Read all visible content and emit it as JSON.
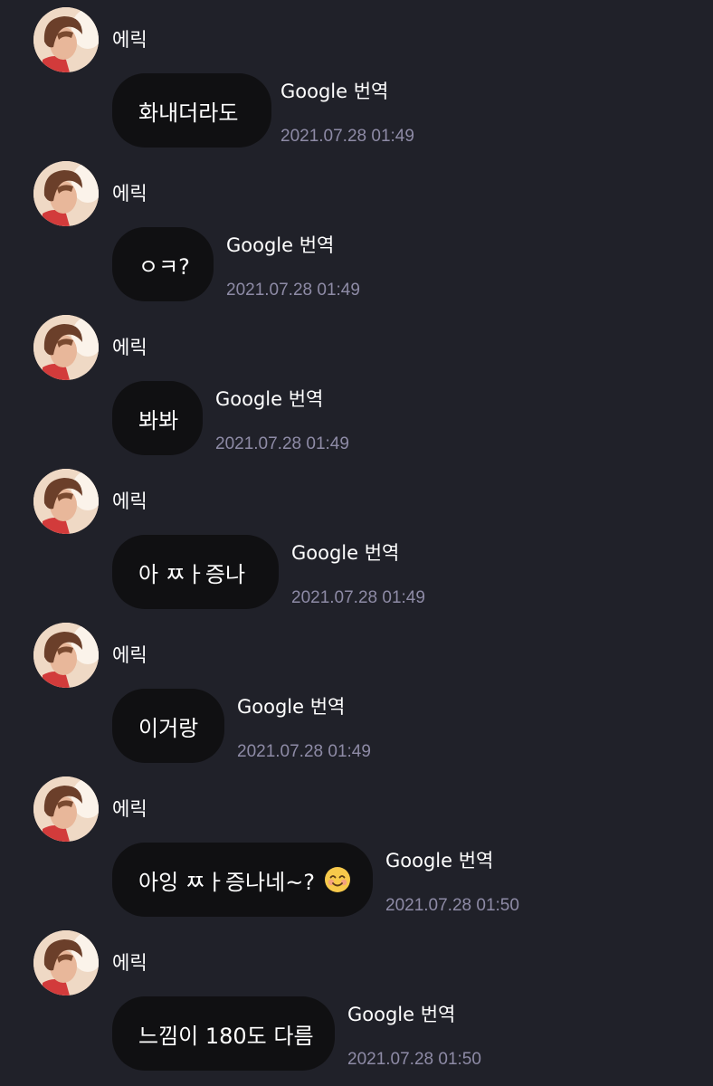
{
  "messages": [
    {
      "sender": "에릭",
      "text": "화내더라도",
      "source": "Google 번역",
      "time": "2021.07.28 01:49"
    },
    {
      "sender": "에릭",
      "text": "ㅇㅋ?",
      "source": "Google 번역",
      "time": "2021.07.28 01:49"
    },
    {
      "sender": "에릭",
      "text": "봐봐",
      "source": "Google 번역",
      "time": "2021.07.28 01:49"
    },
    {
      "sender": "에릭",
      "text": "아 ㅉㅏ증나",
      "source": "Google 번역",
      "time": "2021.07.28 01:49"
    },
    {
      "sender": "에릭",
      "text": "이거랑",
      "source": "Google 번역",
      "time": "2021.07.28 01:49"
    },
    {
      "sender": "에릭",
      "text": "아잉 ㅉㅏ증나네~?",
      "emoji": "smiling-face-emoji",
      "source": "Google 번역",
      "time": "2021.07.28 01:50"
    },
    {
      "sender": "에릭",
      "text": "느낌이 180도 다름",
      "source": "Google 번역",
      "time": "2021.07.28 01:50"
    }
  ]
}
